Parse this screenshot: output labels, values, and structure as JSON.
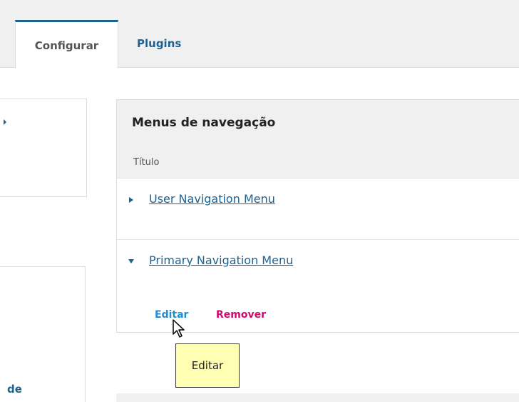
{
  "tabs": [
    {
      "label": "Configurar",
      "active": true
    },
    {
      "label": "Plugins",
      "active": false
    }
  ],
  "sidebar": {
    "partial_text": "de"
  },
  "panel": {
    "title": "Menus de navegação",
    "column_header": "Título",
    "rows": [
      {
        "label": "User Navigation Menu",
        "expanded": false
      },
      {
        "label": "Primary Navigation Menu",
        "expanded": true,
        "actions": {
          "edit": "Editar",
          "remove": "Remover"
        }
      }
    ]
  },
  "tooltip": {
    "text": "Editar"
  },
  "colors": {
    "link": "#1e6292",
    "edit": "#1e8dd6",
    "remove": "#d00a6c",
    "tooltip_bg": "#ffffb4"
  },
  "icons": {
    "collapsed_row": "triangle-right-icon",
    "expanded_row": "triangle-down-icon",
    "pointer": "mouse-pointer-icon"
  }
}
